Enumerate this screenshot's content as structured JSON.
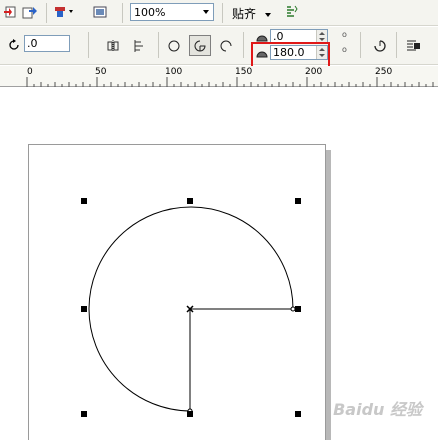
{
  "toolbar": {
    "zoom_value": "100%",
    "snap_label": "贴齐",
    "icons": [
      "import-icon",
      "export-icon",
      "publish-pdf-icon",
      "app-launcher-icon",
      "options-icon"
    ]
  },
  "property_bar": {
    "rotation_value": ".0",
    "start_angle_value": ".0",
    "end_angle_value": "180.0",
    "object_shape_icons": [
      "ellipse-icon",
      "pie-icon",
      "arc-icon"
    ]
  },
  "ruler": {
    "labels": [
      "0",
      "50",
      "100",
      "150",
      "200",
      "250"
    ]
  },
  "colors": {
    "highlight": "#e01818",
    "toolbar_bg": "#f4f4ef"
  },
  "watermark": "Baidu 经验"
}
